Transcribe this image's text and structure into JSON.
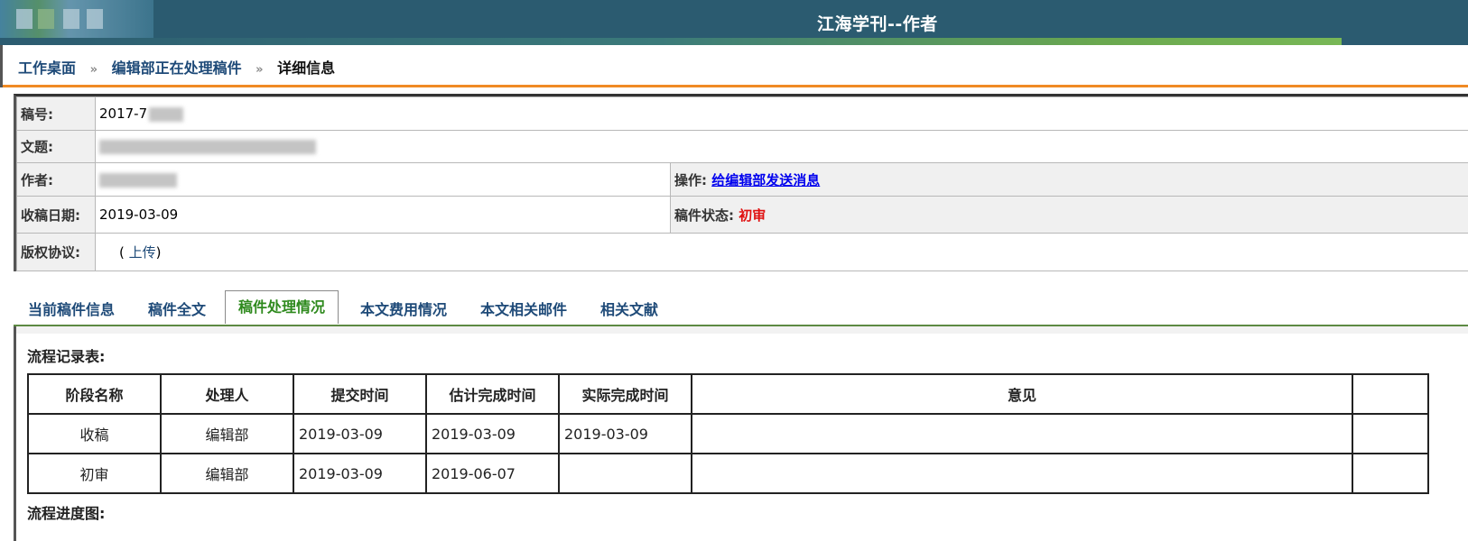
{
  "header": {
    "title": "江海学刊--作者"
  },
  "breadcrumb": {
    "items": [
      "工作桌面",
      "编辑部正在处理稿件",
      "详细信息"
    ],
    "separator": "»"
  },
  "manuscript": {
    "id_label": "稿号:",
    "id_value": "2017-7",
    "title_label": "文题:",
    "author_label": "作者:",
    "action_label": "操作:",
    "action_link": "给编辑部发送消息",
    "received_label": "收稿日期:",
    "received_value": "2019-03-09",
    "status_label": "稿件状态:",
    "status_value": "初审",
    "copyright_label": "版权协议:",
    "copyright_open": "( ",
    "copyright_link": "上传",
    "copyright_close": ")"
  },
  "tabs": [
    "当前稿件信息",
    "稿件全文",
    "稿件处理情况",
    "本文费用情况",
    "本文相关邮件",
    "相关文献"
  ],
  "active_tab": "稿件处理情况",
  "flow": {
    "title": "流程记录表:",
    "columns": [
      "阶段名称",
      "处理人",
      "提交时间",
      "估计完成时间",
      "实际完成时间",
      "意见",
      ""
    ],
    "rows": [
      [
        "收稿",
        "编辑部",
        "2019-03-09",
        "2019-03-09",
        "2019-03-09",
        "",
        ""
      ],
      [
        "初审",
        "编辑部",
        "2019-03-09",
        "2019-06-07",
        "",
        "",
        ""
      ]
    ],
    "progress_title": "流程进度图:"
  },
  "colors": {
    "header_bg": "#2b5b70",
    "accent_orange": "#f08a24",
    "link_blue": "#1e4a78",
    "status_red": "#e01010",
    "active_tab_green": "#2f8a1e"
  }
}
